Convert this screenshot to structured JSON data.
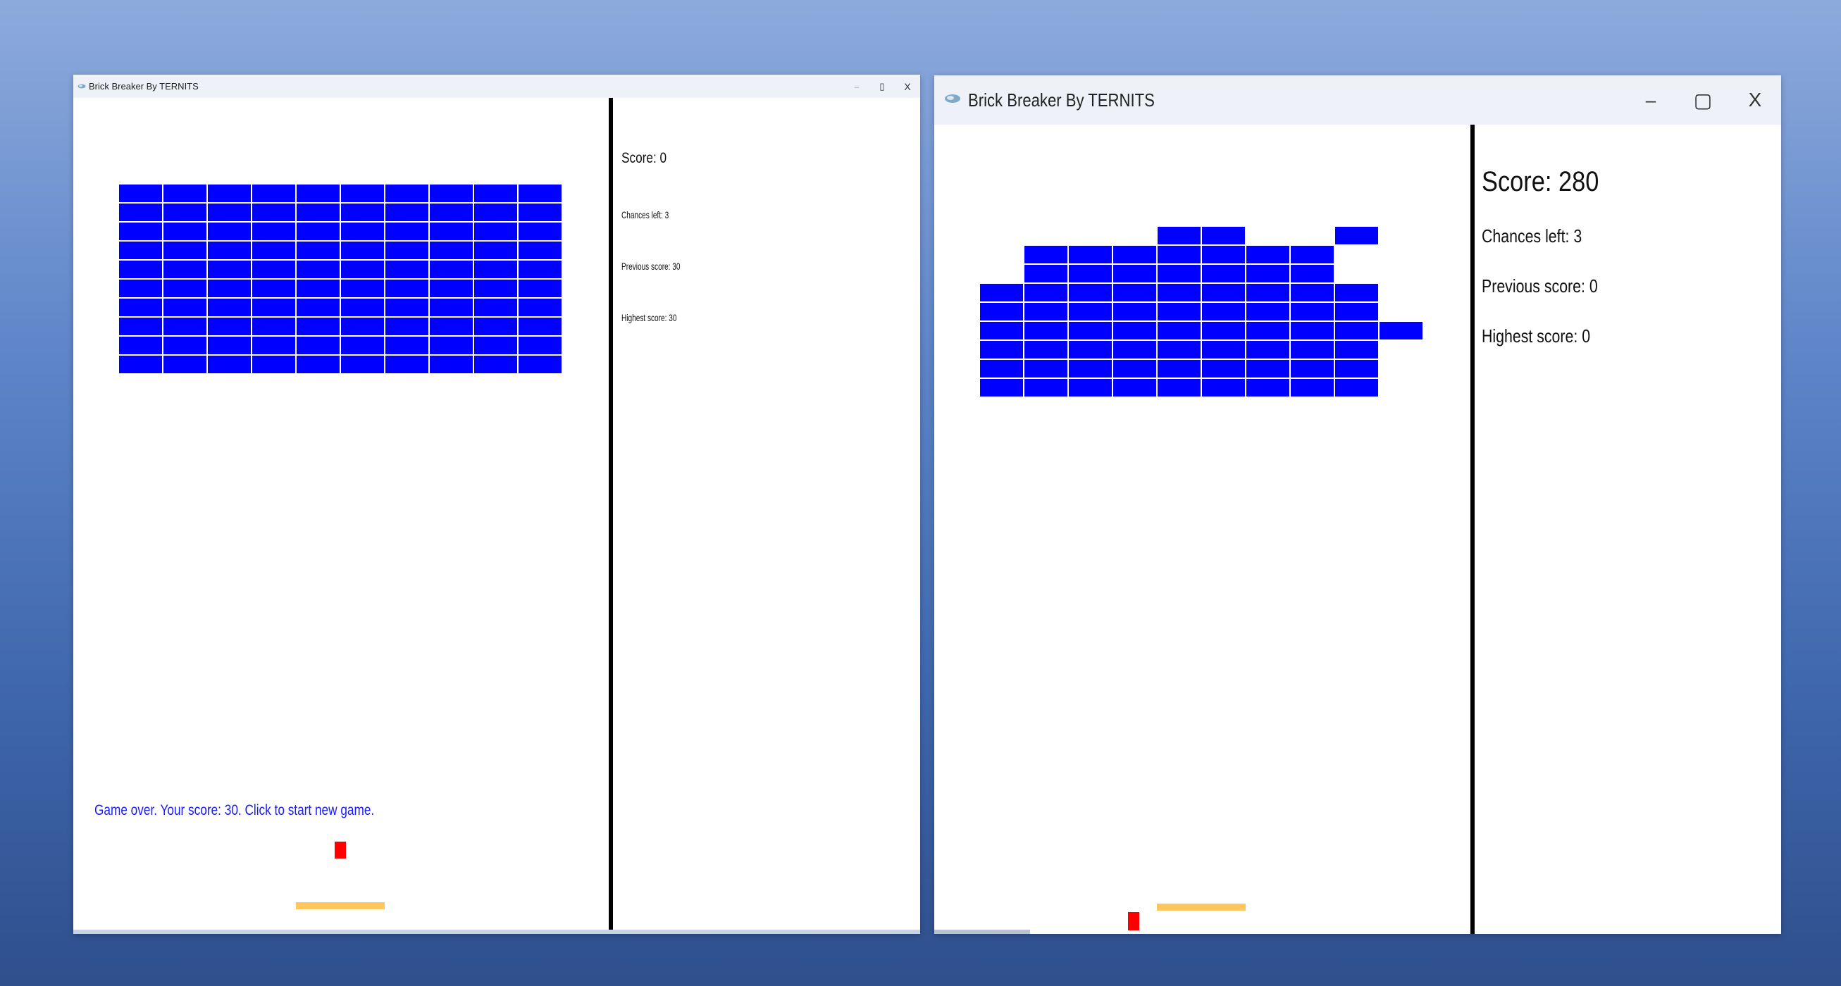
{
  "background": {
    "gradient_top": "#8daadc",
    "gradient_bottom": "#2f4f8c"
  },
  "colors": {
    "brick": "#0000ff",
    "paddle": "#ffc65e",
    "ball": "#ff0000",
    "message": "#1a1aff",
    "divider": "#000000"
  },
  "windows": [
    {
      "title": "Brick Breaker By TERNITS",
      "icon": "game-app-icon",
      "controls": {
        "minimize": "–",
        "maximize": "▯",
        "close": "X"
      },
      "score_label": "Score: 0",
      "chances_label": "Chances left: 3",
      "previous_label": "Previous score: 30",
      "highest_label": "Highest score: 30",
      "message": "Game over. Your score: 30. Click to start new game.",
      "bricks": {
        "cols": 10,
        "rows": 10,
        "present": "all"
      }
    },
    {
      "title": "Brick Breaker By TERNITS",
      "icon": "game-app-icon",
      "controls": {
        "minimize": "–",
        "maximize": "▢",
        "close": "X"
      },
      "score_label": "Score: 280",
      "chances_label": "Chances left: 3",
      "previous_label": "Previous score: 0",
      "highest_label": "Highest score: 0",
      "message": "",
      "bricks": {
        "cols": 10,
        "rows": 10,
        "present": [
          [
            0,
            0,
            0,
            0,
            1,
            1,
            0,
            0,
            1,
            0
          ],
          [
            0,
            1,
            1,
            1,
            1,
            1,
            1,
            1,
            0,
            0
          ],
          [
            0,
            1,
            1,
            1,
            1,
            1,
            1,
            1,
            0,
            0
          ],
          [
            1,
            1,
            1,
            1,
            1,
            1,
            1,
            1,
            1,
            0
          ],
          [
            1,
            1,
            1,
            1,
            1,
            1,
            1,
            1,
            1,
            0
          ],
          [
            1,
            1,
            1,
            1,
            1,
            1,
            1,
            1,
            1,
            1
          ],
          [
            1,
            1,
            1,
            1,
            1,
            1,
            1,
            1,
            1,
            0
          ],
          [
            1,
            1,
            1,
            1,
            1,
            1,
            1,
            1,
            1,
            0
          ],
          [
            1,
            1,
            1,
            1,
            1,
            1,
            1,
            1,
            1,
            0
          ],
          [
            0,
            0,
            0,
            0,
            0,
            0,
            0,
            0,
            0,
            0
          ]
        ]
      }
    }
  ]
}
